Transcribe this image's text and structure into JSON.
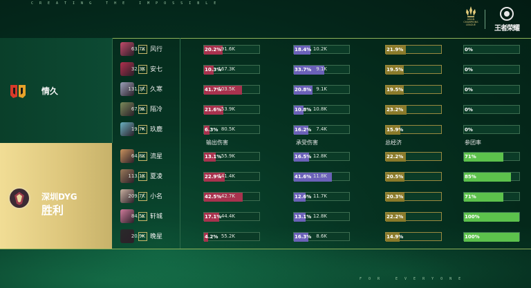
{
  "branding": {
    "tagline_top": "CREATING THE IMPOSSIBLE",
    "tagline_bottom": "FOR EVERYONE",
    "acl_logo_text": "ASIAN CHAMPIONS LEAGUE",
    "game_logo_text": "王者荣耀"
  },
  "columns": {
    "damage": "输出伤害",
    "taken": "承受伤害",
    "gold": "总经济",
    "participation": "参团率"
  },
  "teams": [
    {
      "name": "情久",
      "result": "",
      "players": [
        {
          "name": "风行",
          "role_icon": "jungle",
          "damage": "63.7K",
          "damage_pct": 20.2,
          "taken": "91.6K",
          "taken_pct": 18.4,
          "gold": "10.2K",
          "gold_pct": 21.9,
          "participation_pct": 0,
          "participation_label": "0%"
        },
        {
          "name": "安七",
          "role_icon": "mid",
          "damage": "32.3K",
          "damage_pct": 10.3,
          "taken": "167.3K",
          "taken_pct": 33.7,
          "gold": "9.1K",
          "gold_pct": 19.5,
          "participation_pct": 0,
          "participation_label": "0%"
        },
        {
          "name": "久寒",
          "role_icon": "adc",
          "damage": "131.3K",
          "damage_pct": 41.7,
          "taken": "103.5K",
          "taken_pct": 20.8,
          "gold": "9.1K",
          "gold_pct": 19.5,
          "participation_pct": 0,
          "participation_label": "0%"
        },
        {
          "name": "陌冷",
          "role_icon": "support",
          "damage": "67.9K",
          "damage_pct": 21.6,
          "taken": "53.9K",
          "taken_pct": 10.8,
          "gold": "10.8K",
          "gold_pct": 23.2,
          "participation_pct": 0,
          "participation_label": "0%"
        },
        {
          "name": "玖鹿",
          "role_icon": "clash",
          "damage": "19.7K",
          "damage_pct": 6.3,
          "taken": "80.5K",
          "taken_pct": 16.2,
          "gold": "7.4K",
          "gold_pct": 15.9,
          "participation_pct": 0,
          "participation_label": "0%"
        }
      ]
    },
    {
      "name": "深圳DYG",
      "result": "胜利",
      "players": [
        {
          "name": "流星",
          "role_icon": "jungle",
          "damage": "64.8K",
          "damage_pct": 13.1,
          "taken": "55.9K",
          "taken_pct": 16.5,
          "gold": "12.8K",
          "gold_pct": 22.2,
          "participation_pct": 71,
          "participation_label": "71%"
        },
        {
          "name": "夏凌",
          "role_icon": "mid",
          "damage": "113.1K",
          "damage_pct": 22.9,
          "taken": "141.4K",
          "taken_pct": 41.6,
          "gold": "11.8K",
          "gold_pct": 20.5,
          "participation_pct": 85,
          "participation_label": "85%"
        },
        {
          "name": "小名",
          "role_icon": "adc",
          "damage": "209.7K",
          "damage_pct": 42.5,
          "taken": "42.7K",
          "taken_pct": 12.6,
          "gold": "11.7K",
          "gold_pct": 20.3,
          "participation_pct": 71,
          "participation_label": "71%"
        },
        {
          "name": "轩城",
          "role_icon": "support",
          "damage": "84.5K",
          "damage_pct": 17.1,
          "taken": "44.4K",
          "taken_pct": 13.1,
          "gold": "12.8K",
          "gold_pct": 22.2,
          "participation_pct": 100,
          "participation_label": "100%"
        },
        {
          "name": "晚星",
          "role_icon": "clash",
          "damage": "20.9K",
          "damage_pct": 4.2,
          "taken": "55.2K",
          "taken_pct": 16.3,
          "gold": "8.6K",
          "gold_pct": 14.9,
          "participation_pct": 100,
          "participation_label": "100%"
        }
      ]
    }
  ],
  "colors": {
    "damage": "#a8324e",
    "taken": "#6b61b8",
    "gold": "#8a7a2a",
    "participation": "#5cc24c",
    "team1_logo": "#d83a2a",
    "team2_panel": "#e5cf84"
  }
}
